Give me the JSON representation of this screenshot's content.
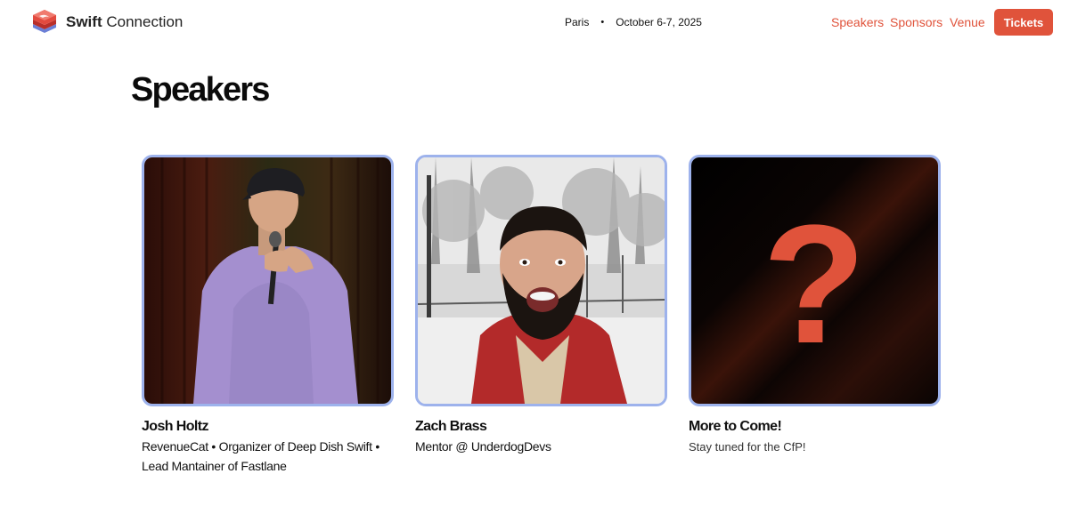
{
  "header": {
    "logo_icon": "swift-connection-logo-icon",
    "brand_bold": "Swift",
    "brand_rest": "Connection",
    "location": "Paris",
    "separator": "•",
    "dates": "October 6-7, 2025",
    "nav": [
      {
        "label": "Speakers"
      },
      {
        "label": "Sponsors"
      },
      {
        "label": "Venue"
      }
    ],
    "tickets_label": "Tickets",
    "accent_color": "#e0533b"
  },
  "page": {
    "title": "Speakers"
  },
  "speakers": [
    {
      "name": "Josh Holtz",
      "role": "RevenueCat • Organizer of Deep Dish Swift • Lead Mantainer of Fastlane",
      "photo_icon": "speaker-photo-josh"
    },
    {
      "name": "Zach Brass",
      "role": "Mentor @ UnderdogDevs",
      "photo_icon": "speaker-photo-zach"
    },
    {
      "name": "More to Come!",
      "note": "Stay tuned for the CfP!",
      "photo_icon": "question-mark-icon",
      "placeholder_glyph": "?"
    }
  ]
}
